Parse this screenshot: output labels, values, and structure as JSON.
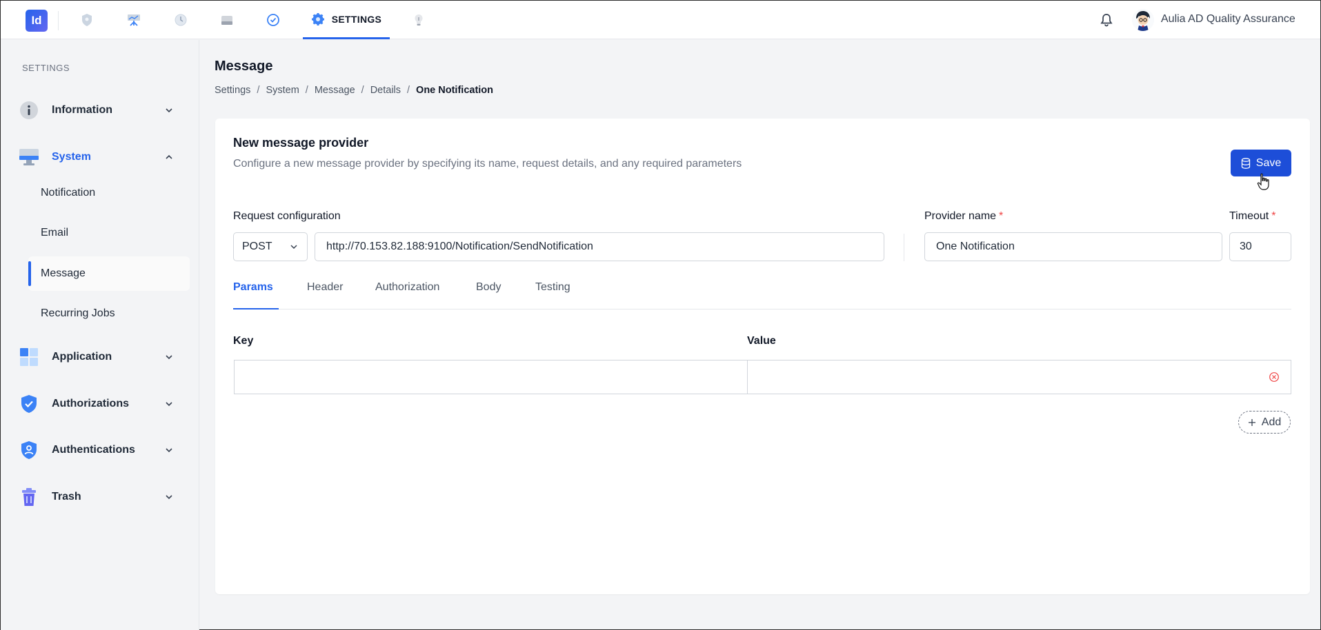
{
  "app": {
    "logo_text": "Id",
    "nav": {
      "active_label": "SETTINGS",
      "icons": [
        "shield-icon",
        "presentation-icon",
        "clock-icon",
        "drive-icon",
        "check-circle-icon",
        "gear-icon",
        "bulb-icon"
      ]
    },
    "user": {
      "name": "Aulia AD Quality Assurance"
    }
  },
  "sidebar": {
    "title": "SETTINGS",
    "items": [
      {
        "label": "Information",
        "icon": "info-icon"
      },
      {
        "label": "System",
        "icon": "monitor-icon",
        "expanded": true
      },
      {
        "label": "Application",
        "icon": "apps-grid-icon"
      },
      {
        "label": "Authorizations",
        "icon": "shield-check-icon"
      },
      {
        "label": "Authentications",
        "icon": "shield-user-icon"
      },
      {
        "label": "Trash",
        "icon": "trash-icon"
      }
    ],
    "system_children": [
      {
        "label": "Notification"
      },
      {
        "label": "Email"
      },
      {
        "label": "Message",
        "active": true
      },
      {
        "label": "Recurring Jobs"
      }
    ]
  },
  "page": {
    "title": "Message",
    "breadcrumb": [
      "Settings",
      "System",
      "Message",
      "Details",
      "One Notification"
    ],
    "breadcrumb_sep": "/"
  },
  "form": {
    "title": "New message provider",
    "description": "Configure a new message provider by specifying its name, request details, and any required parameters",
    "save_label": "Save",
    "request_config_label": "Request configuration",
    "method": "POST",
    "url": "http://70.153.82.188:9100/Notification/SendNotification",
    "provider_name_label": "Provider name",
    "provider_name": "One Notification",
    "timeout_label": "Timeout",
    "timeout": "30",
    "required_mark": "*",
    "tabs": [
      "Params",
      "Header",
      "Authorization",
      "Body",
      "Testing"
    ],
    "active_tab": "Params",
    "params": {
      "key_header": "Key",
      "value_header": "Value",
      "rows": [
        {
          "key": "",
          "value": ""
        }
      ],
      "add_label": "Add"
    }
  },
  "colors": {
    "accent": "#2563eb",
    "save_button": "#1d4ed8",
    "required": "#ef4444"
  }
}
